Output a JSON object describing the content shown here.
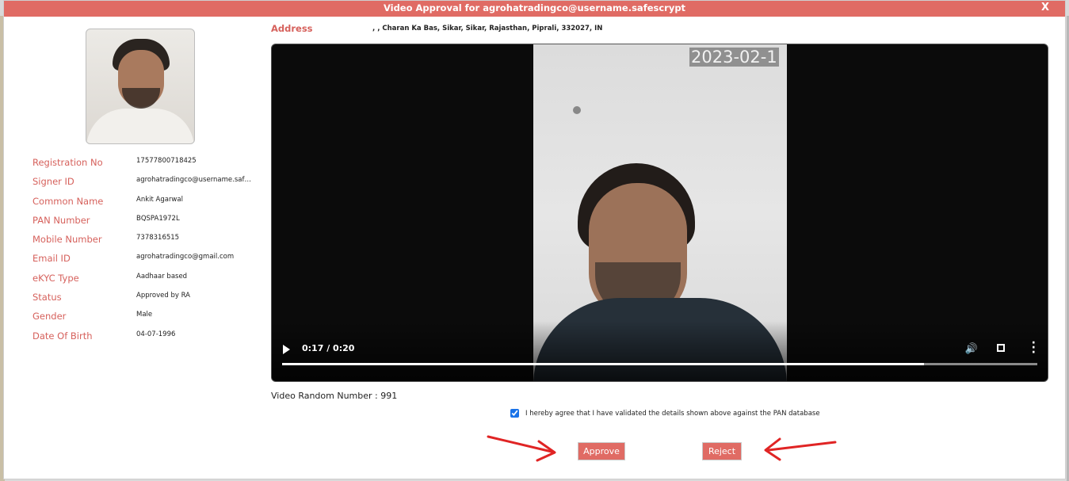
{
  "dialog": {
    "title": "Video Approval for agrohatradingco@username.safescrypt",
    "close_label": "X"
  },
  "details": [
    {
      "label": "Registration No",
      "value": "17577800718425"
    },
    {
      "label": "Signer ID",
      "value": "agrohatradingco@username.safes..."
    },
    {
      "label": "Common Name",
      "value": "Ankit Agarwal"
    },
    {
      "label": "PAN Number",
      "value": "BQSPA1972L"
    },
    {
      "label": "Mobile Number",
      "value": "7378316515"
    },
    {
      "label": "Email ID",
      "value": "agrohatradingco@gmail.com"
    },
    {
      "label": "eKYC Type",
      "value": "Aadhaar based"
    },
    {
      "label": "Status",
      "value": "Approved by RA"
    },
    {
      "label": "Gender",
      "value": "Male"
    },
    {
      "label": "Date Of Birth",
      "value": "04-07-1996"
    }
  ],
  "address": {
    "label": "Address",
    "value": ", , Charan Ka Bas, Sikar, Sikar, Rajasthan, Piprali, 332027, IN"
  },
  "video": {
    "overlay_timestamp": "2023-02-1",
    "time_display": "0:17 / 0:20",
    "progress_fraction": 0.85,
    "icons": [
      "play-icon",
      "volume-icon",
      "fullscreen-icon",
      "more-options-icon"
    ]
  },
  "random_number_text": "Video Random Number : 991",
  "consent": {
    "checked": true,
    "text": "I hereby agree that I have validated the details shown above against the PAN database"
  },
  "actions": {
    "approve_label": "Approve",
    "reject_label": "Reject"
  },
  "colors": {
    "accent": "#e06b64",
    "label": "#d6615c",
    "annotation_arrow": "#e02424"
  }
}
